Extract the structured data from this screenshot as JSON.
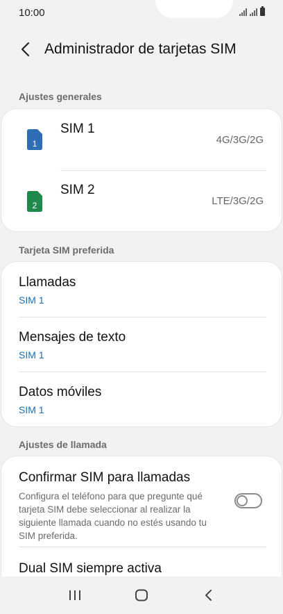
{
  "status_bar": {
    "time": "10:00",
    "icons": [
      "signal-icon",
      "signal-icon",
      "battery-icon"
    ]
  },
  "header": {
    "title": "Administrador de tarjetas SIM",
    "back_icon": "chevron-left-icon"
  },
  "general": {
    "label": "Ajustes generales",
    "sims": [
      {
        "name": "SIM 1",
        "network": "4G/3G/2G",
        "badge": "1",
        "color": "#2f6db5"
      },
      {
        "name": "SIM 2",
        "network": "LTE/3G/2G",
        "badge": "2",
        "color": "#1f8a4c"
      }
    ]
  },
  "preferred": {
    "label": "Tarjeta SIM preferida",
    "items": [
      {
        "title": "Llamadas",
        "value": "SIM 1"
      },
      {
        "title": "Mensajes de texto",
        "value": "SIM 1"
      },
      {
        "title": "Datos móviles",
        "value": "SIM 1"
      }
    ]
  },
  "call_settings": {
    "label": "Ajustes de llamada",
    "confirm": {
      "title": "Confirmar SIM para llamadas",
      "description": "Configura el teléfono para que pregunte qué tarjeta SIM debe seleccionar al realizar la siguiente llamada cuando no estés usando tu SIM preferida.",
      "enabled": false
    },
    "dual_sim": {
      "title": "Dual SIM siempre activa"
    }
  },
  "nav_bar": {
    "icons": [
      "recent-apps-icon",
      "home-icon",
      "back-icon"
    ]
  },
  "colors": {
    "accent": "#1a6fb5",
    "background": "#f2f2f2",
    "card": "#ffffff"
  }
}
